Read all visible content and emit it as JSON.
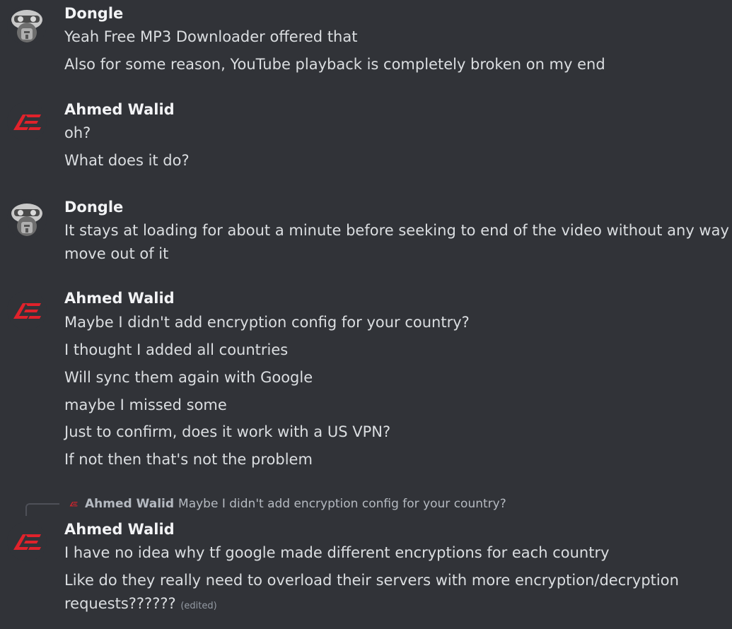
{
  "messages": [
    {
      "author": "Dongle",
      "avatar": "robot-avatar",
      "lines": [
        "Yeah Free MP3 Downloader offered that",
        "Also for some reason, YouTube playback is completely broken on my end"
      ]
    },
    {
      "author": "Ahmed Walid",
      "avatar": "ae-logo-avatar",
      "lines": [
        "oh?",
        "What does it do?"
      ]
    },
    {
      "author": "Dongle",
      "avatar": "robot-avatar",
      "lines": [
        "It stays at loading for about a minute before seeking to end of the video without any way to",
        "move out of it"
      ]
    },
    {
      "author": "Ahmed Walid",
      "avatar": "ae-logo-avatar",
      "lines": [
        "Maybe I didn't add encryption config for your country?",
        "I thought I added all countries",
        "Will sync them again with Google",
        "maybe I missed some",
        "Just to confirm, does it work with a US VPN?",
        "If not then that's not the problem"
      ]
    },
    {
      "author": "Ahmed Walid",
      "avatar": "ae-logo-avatar",
      "reply": {
        "author": "Ahmed Walid",
        "text": "Maybe I didn't add encryption config for your country?"
      },
      "lines": [
        "I have no idea why tf google made different encryptions for each country",
        "Like do they really need to overload their servers with more encryption/decryption",
        "requests??????"
      ],
      "edited_label": "(edited)"
    }
  ],
  "colors": {
    "background": "#313338",
    "text": "#dbdee1",
    "author": "#f2f3f5",
    "muted": "#949ba4",
    "logo_red": "#e0222b"
  }
}
